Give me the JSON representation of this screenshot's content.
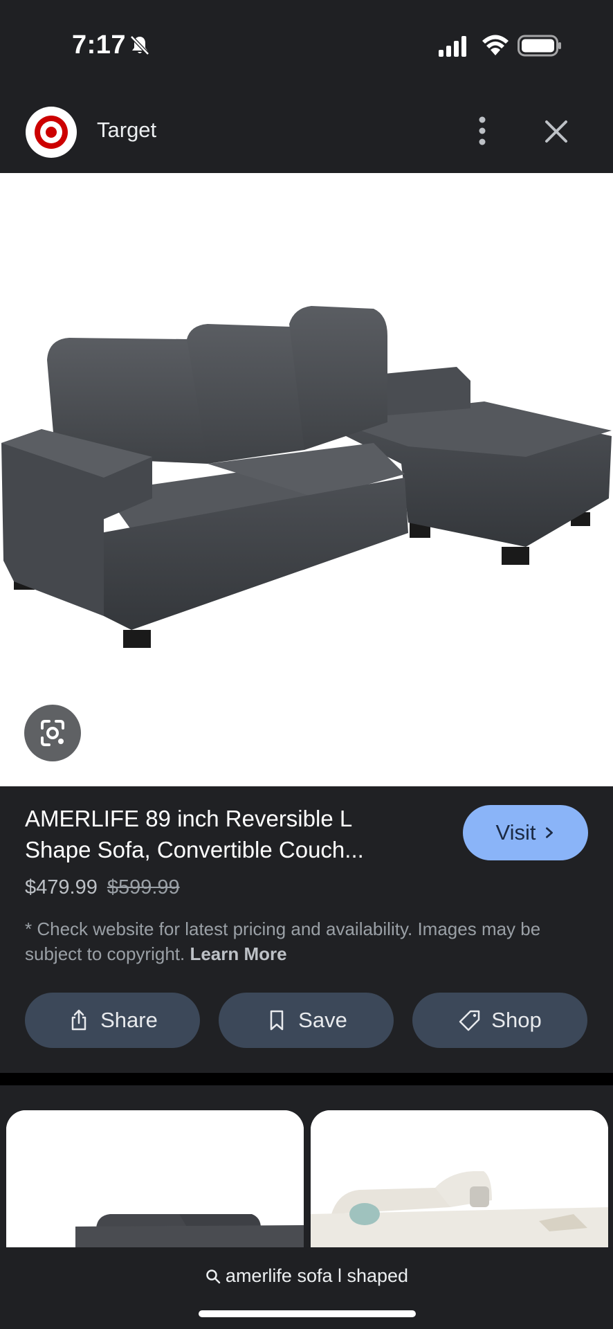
{
  "status_bar": {
    "time": "7:17"
  },
  "header": {
    "site_name": "Target",
    "logo_icon": "target-bullseye-logo",
    "brand_color": "#cc0000"
  },
  "product": {
    "title_line1": "AMERLIFE 89 inch Reversible L",
    "title_line2": "Shape Sofa, Convertible Couch...",
    "price": "$479.99",
    "original_price": "$599.99",
    "disclaimer": "* Check website for latest pricing and availability. Images may be subject to copyright.",
    "learn_more": "Learn More",
    "visit_label": "Visit"
  },
  "actions": {
    "share_label": "Share",
    "save_label": "Save",
    "shop_label": "Shop"
  },
  "search": {
    "query": "amerlife sofa l shaped"
  },
  "colors": {
    "background": "#202124",
    "accent_button": "#8ab4f8",
    "chip_background": "#3c4859"
  }
}
